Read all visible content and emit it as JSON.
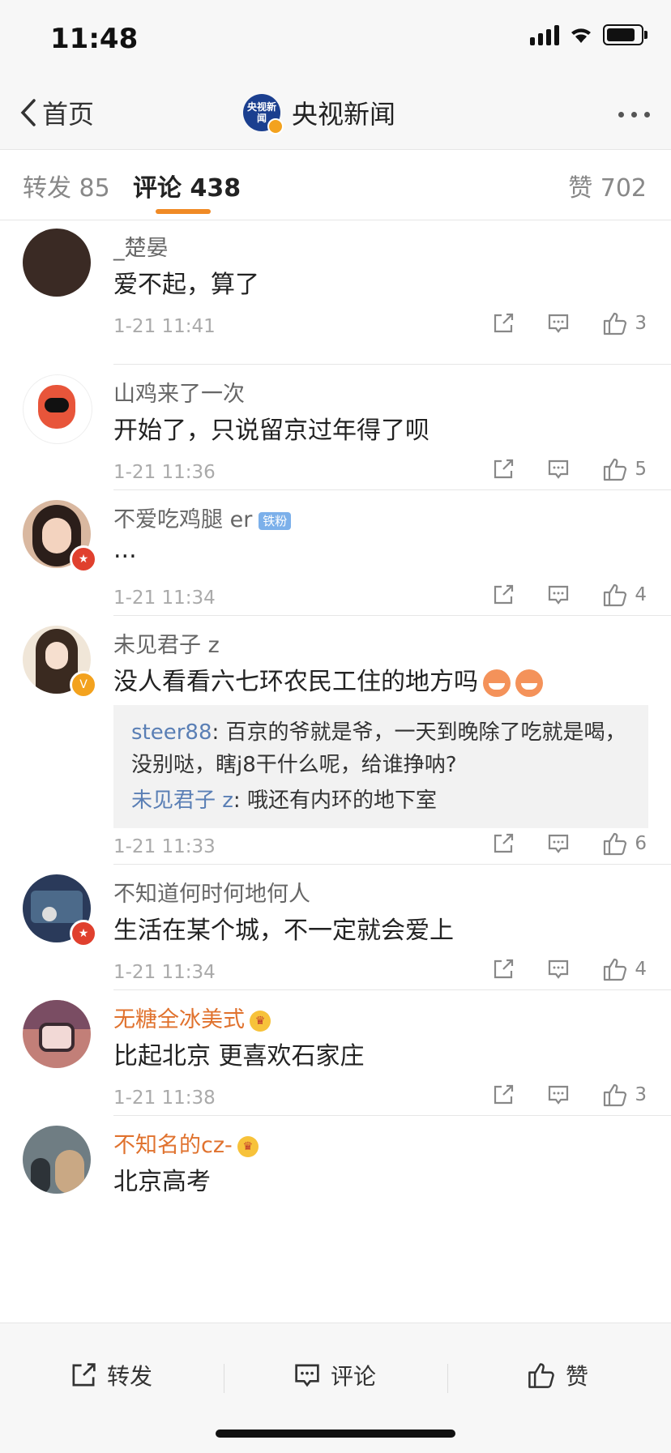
{
  "status": {
    "time": "11:48"
  },
  "nav": {
    "back_label": "首页",
    "title": "央视新闻",
    "avatar_text": "央视新闻"
  },
  "tabs": {
    "repost": {
      "label": "转发",
      "count": "85"
    },
    "comment": {
      "label": "评论",
      "count": "438"
    },
    "like": {
      "label": "赞",
      "count": "702"
    }
  },
  "comments": [
    {
      "name": "_楚晏",
      "text": "爱不起，算了",
      "time": "1-21 11:41",
      "likes": "3",
      "avatar_color": "#3a2a24"
    },
    {
      "name": "山鸡来了一次",
      "text": "开始了，只说留京过年得了呗",
      "time": "1-21 11:36",
      "likes": "5",
      "avatar_color": "#e8553a"
    },
    {
      "name": "不爱吃鸡腿 er",
      "tag": "铁粉",
      "text": "...",
      "time": "1-21 11:34",
      "likes": "4",
      "avatar_color": "#d9b8a0"
    },
    {
      "name": "未见君子 z",
      "text": "没人看看六七环农民工住的地方吗",
      "time": "1-21 11:33",
      "likes": "6",
      "avatar_color": "#b58d6a",
      "replies": [
        {
          "user": "steer88",
          "sep": ": ",
          "text": "百京的爷就是爷，一天到晚除了吃就是喝，没别哒，瞎j8干什么呢，给谁挣呐?"
        },
        {
          "user": "未见君子 z",
          "sep": ": ",
          "text": "哦还有内环的地下室"
        }
      ]
    },
    {
      "name": "不知道何时何地何人",
      "text": "生活在某个城，不一定就会爱上",
      "time": "1-21 11:34",
      "likes": "4",
      "avatar_color": "#2a3a5a"
    },
    {
      "name": "无糖全冰美式",
      "text": "比起北京 更喜欢石家庄",
      "time": "1-21 11:38",
      "likes": "3",
      "avatar_color": "#c27f78"
    },
    {
      "name": "不知名的cz-",
      "text": "北京高考",
      "avatar_color": "#6f7d83"
    }
  ],
  "bottom": {
    "repost_label": "转发",
    "comment_label": "评论",
    "like_label": "赞"
  }
}
